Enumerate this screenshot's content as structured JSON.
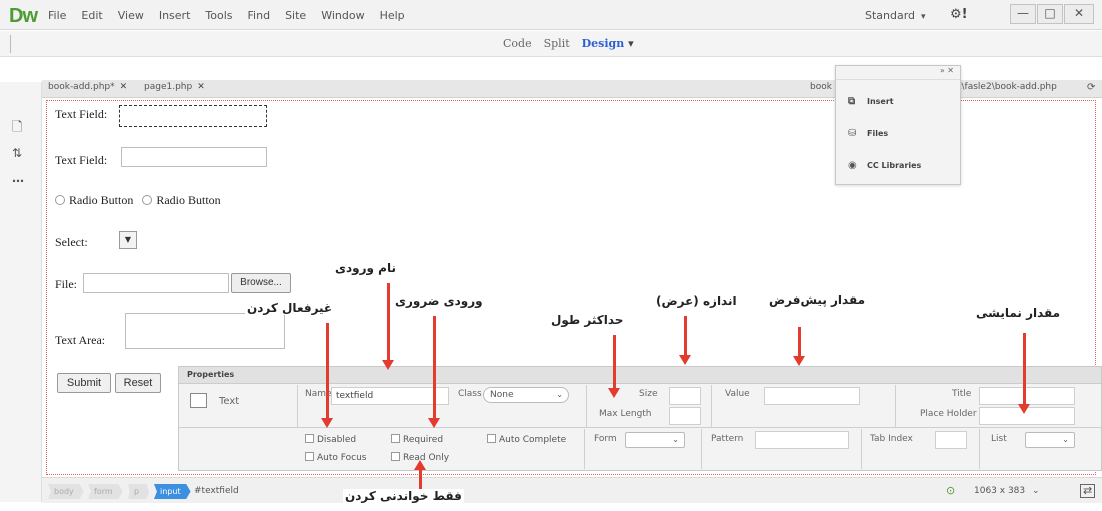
{
  "app": {
    "logo": "Dw",
    "workspace": "Standard",
    "sync": "⚙!"
  },
  "menu": [
    "File",
    "Edit",
    "View",
    "Insert",
    "Tools",
    "Find",
    "Site",
    "Window",
    "Help"
  ],
  "window_buttons": {
    "minimize": "—",
    "maximize": "□",
    "close": "✕"
  },
  "views": {
    "code": "Code",
    "split": "Split",
    "design": "Design"
  },
  "tabs": [
    {
      "label": "book-add.php*"
    },
    {
      "label": "page1.php"
    }
  ],
  "tab_path": {
    "prefix": "book",
    "path": "t\\fasle2\\book-add.php"
  },
  "floating_panel": {
    "items": [
      "Insert",
      "Files",
      "CC Libraries"
    ]
  },
  "form": {
    "text_field_1": "Text Field:",
    "text_field_2": "Text Field:",
    "radio_1": "Radio Button",
    "radio_2": "Radio Button",
    "select": "Select:",
    "file": "File:",
    "browse": "Browse...",
    "text_area": "Text Area:",
    "submit": "Submit",
    "reset": "Reset"
  },
  "properties": {
    "tab": "Properties",
    "element_type": "Text",
    "name_label": "Name",
    "name_value": "textfield",
    "class_label": "Class",
    "class_value": "None",
    "size_label": "Size",
    "max_length_label": "Max Length",
    "value_label": "Value",
    "title_label": "Title",
    "placeholder_label": "Place Holder",
    "checks": {
      "disabled": "Disabled",
      "required": "Required",
      "auto_complete": "Auto Complete",
      "auto_focus": "Auto Focus",
      "read_only": "Read Only"
    },
    "form_label": "Form",
    "pattern_label": "Pattern",
    "tab_index_label": "Tab Index",
    "list_label": "List"
  },
  "status": {
    "crumbs": [
      "body",
      "form",
      "p",
      "input"
    ],
    "selected": "#textfield",
    "dimensions": "1063 x 383"
  },
  "annotations": {
    "input_name": "نام ورودی",
    "disable": "غیرفعال کردن",
    "required": "ورودی ضروری",
    "max_length": "حداکثر طول",
    "size_width": "اندازه (عرض)",
    "default_value": "مقدار پیش‌فرض",
    "display_value": "مقدار نمایشی",
    "read_only": "فقط خواندنی کردن"
  },
  "colors": {
    "logo": "#4e9a34",
    "active_view": "#2d5fd4",
    "arrow": "#e33b2e",
    "selected_crumb": "#3d8fe0"
  }
}
